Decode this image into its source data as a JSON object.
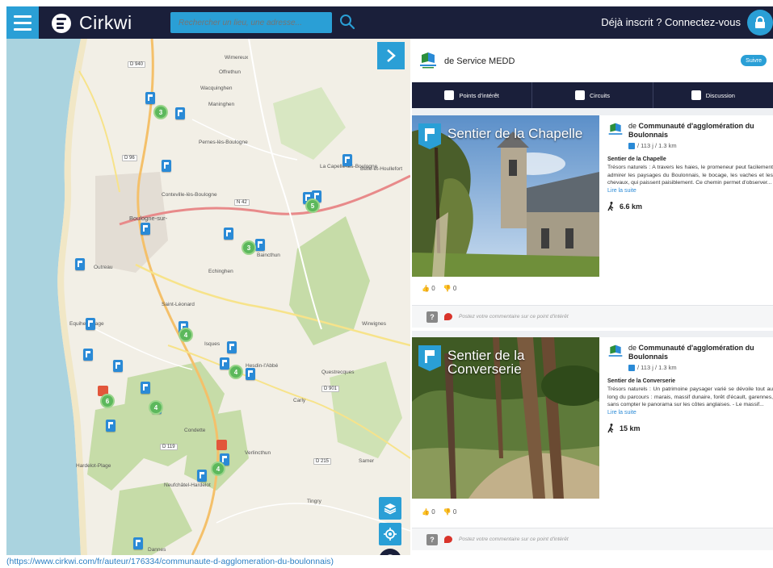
{
  "topbar": {
    "logo": "Cirkwi",
    "search_placeholder": "Rechercher un lieu, une adresse...",
    "login": "Déjà inscrit ? Connectez-vous"
  },
  "map": {
    "places": [
      "Boulogne-sur-",
      "Outreau",
      "Equihen-Plage",
      "Hardelot-Plage",
      "Condette",
      "Neufchâtel-Hardelot",
      "Saint-Léonard",
      "Echinghen",
      "Pernes-lès-Boulogne",
      "Conteville-lès-Boulogne",
      "Baincthun",
      "Wimereux",
      "Questrecques",
      "Carly",
      "Samer",
      "Tingry",
      "Dannes",
      "Wirwignes",
      "Hesdin-l'Abbé",
      "Isques",
      "Maninghen",
      "Offrethun",
      "Wacquinghen",
      "Belle-et-Houllefort",
      "La Capelle-lès-Boulogne",
      "Verlincthun"
    ],
    "roads": [
      "D 940",
      "D 96",
      "N 42",
      "D 119",
      "D 901",
      "D 215"
    ],
    "clusters": [
      "3",
      "5",
      "3",
      "4",
      "4",
      "6",
      "4",
      "4"
    ]
  },
  "panel": {
    "author": "de Service MEDD",
    "follow": "Suivre",
    "tabs": [
      "Points d'intérêt",
      "Circuits",
      "Discussion"
    ],
    "cards": [
      {
        "title": "Sentier de la Chapelle",
        "author_prefix": "de",
        "author_name": "Communauté d'agglomération du Boulonnais",
        "stats": "/ 113 j / 1.3 km",
        "name": "Sentier de la Chapelle",
        "desc": "Trésors naturels : A travers les haies, le promeneur peut facilement admirer les paysages du Boulonnais, le bocage, les vaches et les chevaux, qui paissent paisiblement. Ce chemin permet d'observer...",
        "more": "Lire la suite",
        "distance": "6.6 km",
        "likes": "0",
        "dislikes": "0",
        "comment": "Postez votre commentaire sur ce point d'intérêt"
      },
      {
        "title": "Sentier de la Converserie",
        "author_prefix": "de",
        "author_name": "Communauté d'agglomération du Boulonnais",
        "stats": "/ 113 j / 1.3 km",
        "name": "Sentier de la Converserie",
        "desc": "Trésors naturels : Un patrimoine paysager varié se dévoile tout au long du parcours : marais, massif dunaire, forêt d'écault, garennes, sans compter le panorama sur les côtes anglaises. - Le massif...",
        "more": "Lire la suite",
        "distance": "15 km",
        "likes": "0",
        "dislikes": "0",
        "comment": "Postez votre commentaire sur ce point d'intérêt"
      }
    ]
  },
  "caption": "(https://www.cirkwi.com/fr/auteur/176334/communaute-d-agglomeration-du-boulonnais)",
  "colors": {
    "navy": "#1a1f3a",
    "blue": "#2a9fd6",
    "pin": "#2a8ad6",
    "cluster": "#5cb85c",
    "forest": "#c6dca8"
  }
}
